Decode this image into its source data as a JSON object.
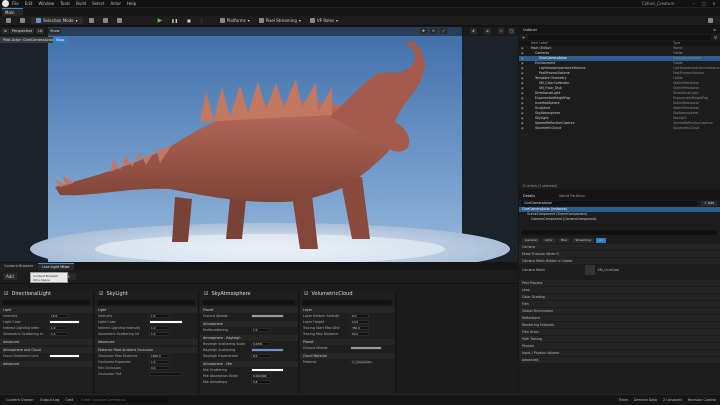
{
  "menu": {
    "items": [
      "File",
      "Edit",
      "Window",
      "Tools",
      "Build",
      "Select",
      "Actor",
      "Help"
    ],
    "project": "Collosi_Creature"
  },
  "level_tab": "Main",
  "toolbar": {
    "mode": "Selection Mode",
    "platforms": "Platforms",
    "pixel": "Pixel Streaming",
    "vp": "VP Roles"
  },
  "viewport": {
    "perspective": "Perspective",
    "lit": "Lit",
    "show": "Show",
    "pilot": "Pilot Actor: CineCameraActor",
    "stop": "Stop"
  },
  "dock": {
    "tab1": "Content Browser",
    "tab2": "Live Light Mixer",
    "tooltip_title": "Content Browser",
    "tooltip_sub": "Ctrl+Space",
    "filter": "Movable",
    "add": "Add"
  },
  "columns": [
    {
      "title": "DirectionalLight",
      "rows": [
        {
          "s": "Light"
        },
        {
          "l": "Intensity",
          "v": "10.0"
        },
        {
          "l": "Light Color",
          "c": "#ffffff"
        },
        {
          "l": "Indirect Lighting Inten",
          "v": "1.0"
        },
        {
          "l": "Volumetric Scattering In",
          "v": "1.0"
        },
        {
          "s": "Advanced"
        },
        {
          "s": "Atmosphere and Cloud"
        },
        {
          "l": "Cloud Scattered Lumi",
          "c": "#ffffff"
        },
        {
          "s": "Advanced"
        }
      ]
    },
    {
      "title": "SkyLight",
      "rows": [
        {
          "s": "Light"
        },
        {
          "l": "Intensity",
          "v": "1.0"
        },
        {
          "l": "Light Color",
          "c": "#ffffff"
        },
        {
          "l": "Indirect Lighting Intensity",
          "v": "1.0"
        },
        {
          "l": "Volumetric Scattering Int",
          "v": "1.0"
        },
        {
          "s": "Advanced"
        },
        {
          "s": "Distance Field Ambient Occlusion"
        },
        {
          "l": "Occlusion Max Distance",
          "v": "1000.0"
        },
        {
          "l": "Occlusion Exponent",
          "v": "1.0"
        },
        {
          "l": "Min Occlusion",
          "v": "0.0"
        },
        {
          "l": "Occlusion Tint",
          "c": "#111111"
        }
      ]
    },
    {
      "title": "SkyAtmosphere",
      "rows": [
        {
          "s": "Planet"
        },
        {
          "l": "Ground Albedo",
          "c": "#9a9a9a"
        },
        {
          "s": "Atmosphere"
        },
        {
          "l": "Multiscattering",
          "v": "1.0"
        },
        {
          "s": "Atmosphere - Rayleigh"
        },
        {
          "l": "Rayleigh Scattering Scale",
          "v": "0.0331"
        },
        {
          "l": "Rayleigh Scattering",
          "c": "#6f8fcf"
        },
        {
          "l": "Rayleigh Exponential",
          "v": "8.0"
        },
        {
          "s": "Atmosphere - Mie"
        },
        {
          "l": "Mie Scattering",
          "c": "#ffffff"
        },
        {
          "l": "Mie Absorption Scale",
          "v": "0.004400"
        },
        {
          "l": "Mie Anisotropy",
          "v": "0.8"
        }
      ]
    },
    {
      "title": "VolumetricCloud",
      "rows": [
        {
          "s": "Layer"
        },
        {
          "l": "Layer Bottom Altitude",
          "v": "6.0"
        },
        {
          "l": "Layer Height",
          "v": "10.0"
        },
        {
          "l": "Tracing Start Max Dist",
          "v": "350.0"
        },
        {
          "l": "Tracing Max Distance",
          "v": "50.0"
        },
        {
          "s": "Planet"
        },
        {
          "l": "Ground Albedo",
          "c": "#9a9a9a"
        },
        {
          "s": "Cloud Material"
        },
        {
          "l": "Material",
          "v": "m_SimpleVolu"
        }
      ]
    }
  ],
  "outliner": {
    "title": "Outliner",
    "col_label": "Item Label",
    "col_type": "Type",
    "count": "12 actors (1 selected)",
    "tab2": "World Partition",
    "rows": [
      {
        "t": "Main (Editor)",
        "y": "World",
        "d": 0
      },
      {
        "t": "Cameras",
        "y": "Folder",
        "d": 1
      },
      {
        "t": "CineCameraActor",
        "y": "CineCameraActor",
        "d": 2,
        "sel": true
      },
      {
        "t": "Environment",
        "y": "Folder",
        "d": 1
      },
      {
        "t": "LightmassImportanceVolume",
        "y": "LightmassImportanceVolume",
        "d": 2
      },
      {
        "t": "PostProcessVolume",
        "y": "PostProcessVolume",
        "d": 2
      },
      {
        "t": "Template Geometry",
        "y": "Folder",
        "d": 1
      },
      {
        "t": "SM_ColorCalibrator",
        "y": "StaticMeshActor",
        "d": 2
      },
      {
        "t": "SM_Floor_Disk",
        "y": "StaticMeshActor",
        "d": 2
      },
      {
        "t": "DirectionalLight",
        "y": "DirectionalLight",
        "d": 1
      },
      {
        "t": "ExponentialHeightFog",
        "y": "ExponentialHeightFog",
        "d": 1
      },
      {
        "t": "InvertedSphere",
        "y": "StaticMeshActor",
        "d": 1
      },
      {
        "t": "Sculpture",
        "y": "StaticMeshActor",
        "d": 1
      },
      {
        "t": "SkyAtmosphere",
        "y": "SkyAtmosphere",
        "d": 1
      },
      {
        "t": "SkyLight",
        "y": "SkyLight",
        "d": 1
      },
      {
        "t": "SphereReflectionCapture",
        "y": "SphereReflectionCapture",
        "d": 1
      },
      {
        "t": "VolumetricCloud",
        "y": "VolumetricCloud",
        "d": 1
      }
    ]
  },
  "details": {
    "title": "Details",
    "actor": "CineCameraActor",
    "add": "+ Add",
    "instance": "CineCameraActor (Instance)",
    "comp1": "SceneComponent (SceneComponent)",
    "comp2": "CameraComponent (CameraComponent)",
    "filters": [
      "General",
      "Actor",
      "Misc",
      "Streaming",
      "All"
    ],
    "sections": [
      "Camera",
      "Draw Frustum When S",
      "Camera Mesh Hidden in Game",
      "Camera Mesh",
      "Post Process",
      "Lens",
      "Color Grading",
      "Film",
      "Global Illumination",
      "Reflections",
      "Rendering Features",
      "Film Grain",
      "Path Tracing",
      "Physics",
      "Input / Physics Volume",
      "Advanced"
    ],
    "mesh": "SM_CineCam"
  },
  "status": {
    "drawer": "Content Drawer",
    "log": "Output Log",
    "cmd": "Cmd",
    "cmd_placeholder": "Enter Console Command",
    "trace": "Trace",
    "derived": "Derived Data",
    "unsaved": "2 Unsaved",
    "revision": "Revision Control"
  }
}
